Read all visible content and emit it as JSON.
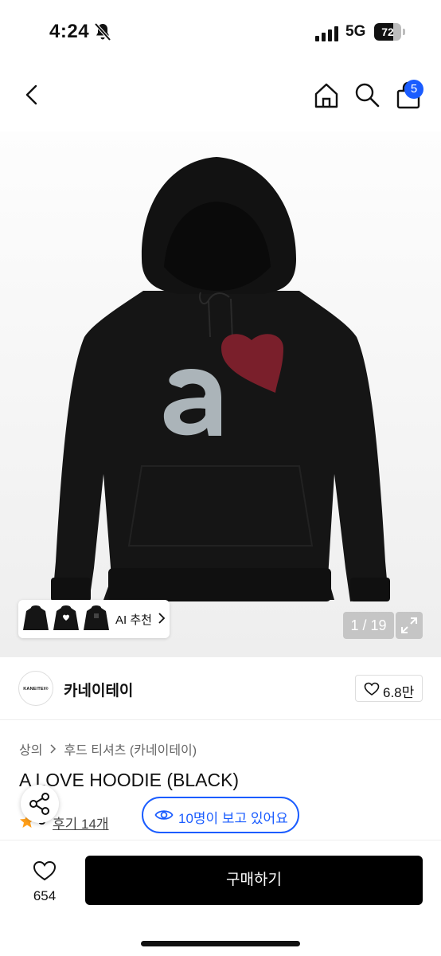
{
  "status_bar": {
    "time": "4:24",
    "network": "5G",
    "battery": "72",
    "battery_level": 0.72
  },
  "header": {
    "cart_count": "5"
  },
  "gallery": {
    "ai_label": "AI 추천",
    "page_counter": "1 / 19"
  },
  "brand": {
    "logo_text": "KANEITEI®",
    "name": "카네이테이",
    "likes": "6.8만"
  },
  "breadcrumb": [
    "상의",
    "후드 티셔츠 (카네이테이)"
  ],
  "product": {
    "title": "A LOVE HOODIE (BLACK)",
    "rating": "5",
    "reviews": "후기 14개",
    "viewers": "10명이 보고 있어요"
  },
  "bottom_bar": {
    "like_count": "654",
    "buy_label": "구매하기"
  },
  "colors": {
    "accent": "#1a5cff",
    "star": "#ff9f1a",
    "buy_button": "#000000",
    "heart_print": "#7a1f2b"
  }
}
